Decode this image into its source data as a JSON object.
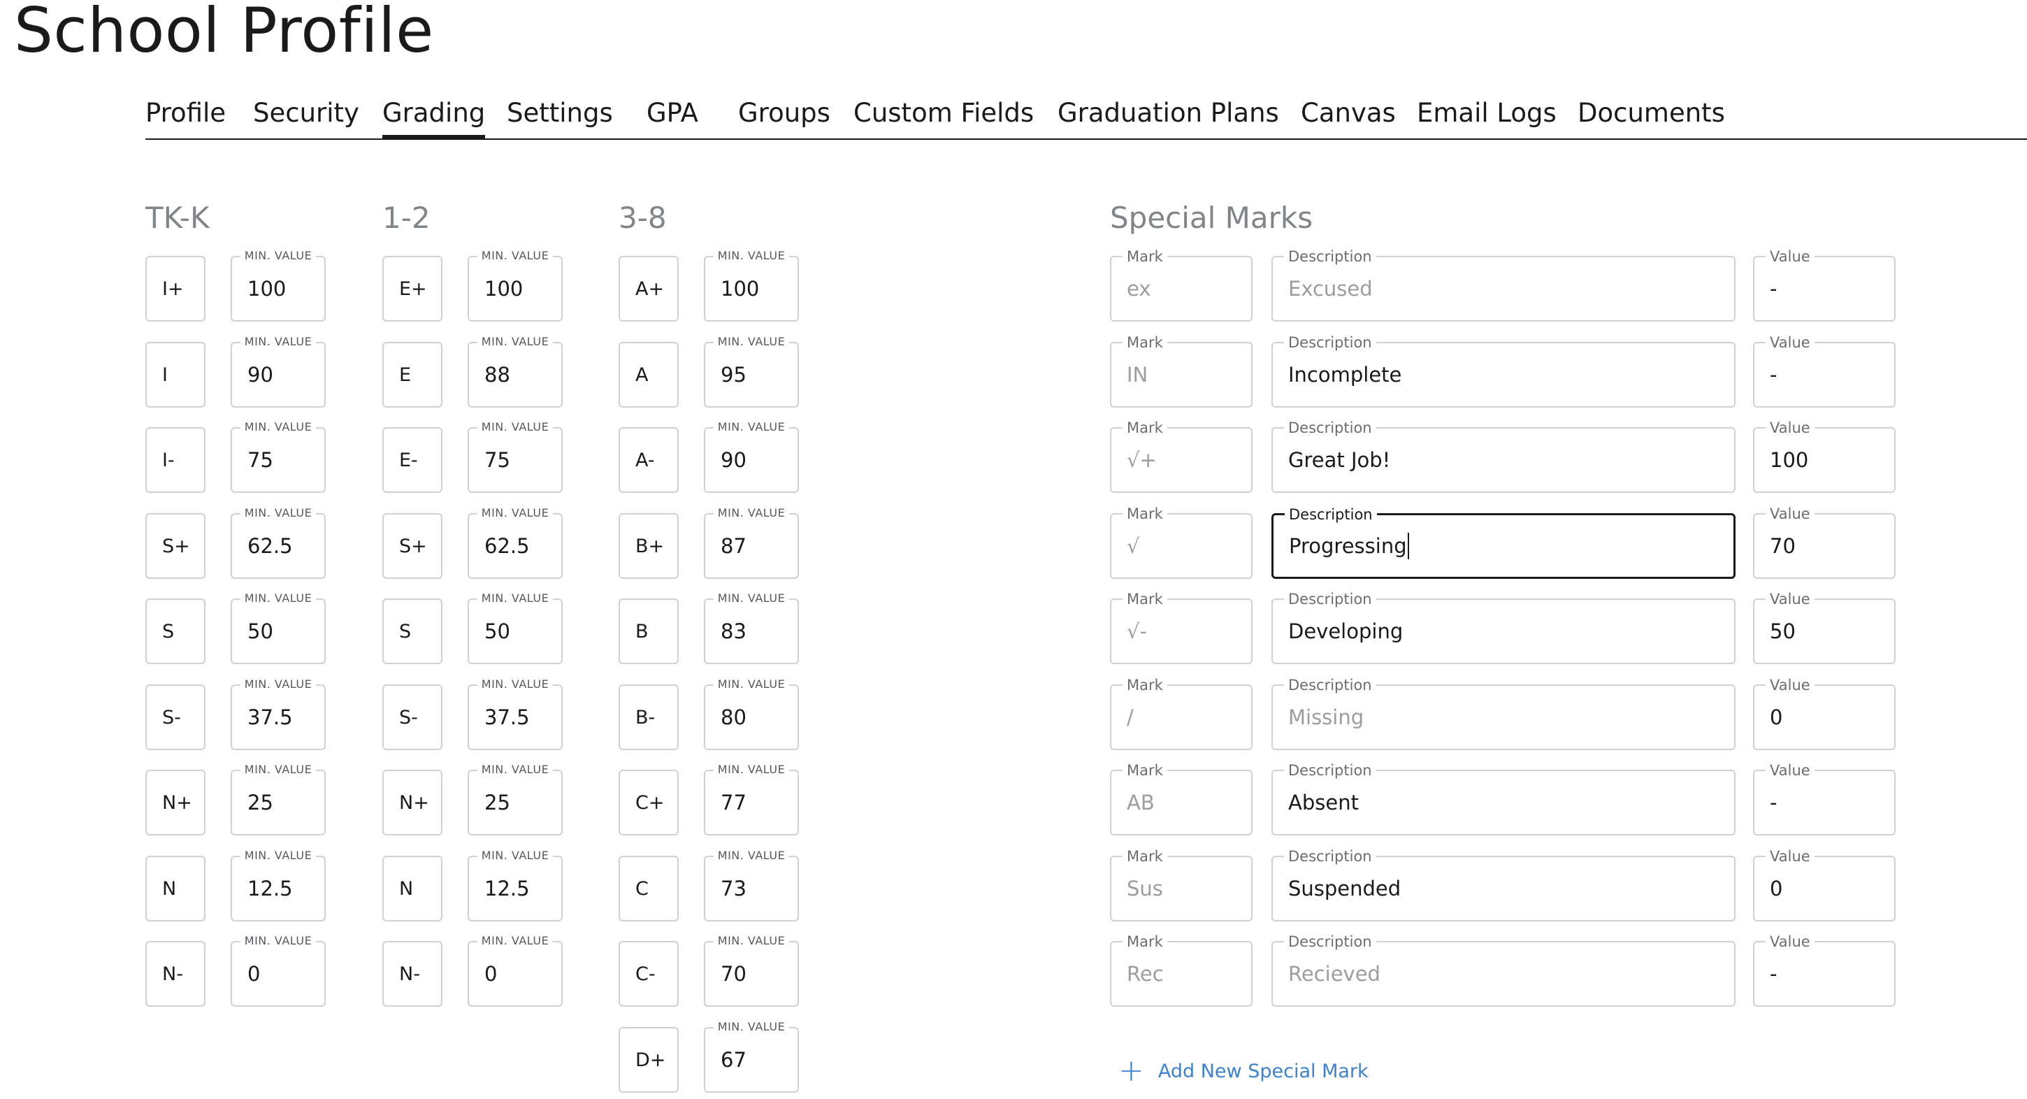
{
  "page_title": "School Profile",
  "tabs": [
    "Profile",
    "Security",
    "Grading",
    "Settings",
    "GPA",
    "Groups",
    "Custom Fields",
    "Graduation Plans",
    "Canvas",
    "Email Logs",
    "Documents"
  ],
  "active_tab": "Grading",
  "min_value_label": "MIN. VALUE",
  "grade_scales": [
    {
      "heading": "TK-K",
      "rows": [
        {
          "mark": "I+",
          "min": "100"
        },
        {
          "mark": "I",
          "min": "90"
        },
        {
          "mark": "I-",
          "min": "75"
        },
        {
          "mark": "S+",
          "min": "62.5"
        },
        {
          "mark": "S",
          "min": "50"
        },
        {
          "mark": "S-",
          "min": "37.5"
        },
        {
          "mark": "N+",
          "min": "25"
        },
        {
          "mark": "N",
          "min": "12.5"
        },
        {
          "mark": "N-",
          "min": "0"
        }
      ]
    },
    {
      "heading": "1-2",
      "rows": [
        {
          "mark": "E+",
          "min": "100"
        },
        {
          "mark": "E",
          "min": "88"
        },
        {
          "mark": "E-",
          "min": "75"
        },
        {
          "mark": "S+",
          "min": "62.5"
        },
        {
          "mark": "S",
          "min": "50"
        },
        {
          "mark": "S-",
          "min": "37.5"
        },
        {
          "mark": "N+",
          "min": "25"
        },
        {
          "mark": "N",
          "min": "12.5"
        },
        {
          "mark": "N-",
          "min": "0"
        }
      ]
    },
    {
      "heading": "3-8",
      "rows": [
        {
          "mark": "A+",
          "min": "100"
        },
        {
          "mark": "A",
          "min": "95"
        },
        {
          "mark": "A-",
          "min": "90"
        },
        {
          "mark": "B+",
          "min": "87"
        },
        {
          "mark": "B",
          "min": "83"
        },
        {
          "mark": "B-",
          "min": "80"
        },
        {
          "mark": "C+",
          "min": "77"
        },
        {
          "mark": "C",
          "min": "73"
        },
        {
          "mark": "C-",
          "min": "70"
        },
        {
          "mark": "D+",
          "min": "67"
        }
      ]
    }
  ],
  "special_marks": {
    "heading": "Special Marks",
    "labels": {
      "mark": "Mark",
      "description": "Description",
      "value": "Value"
    },
    "rows": [
      {
        "mark": "ex",
        "description": "Excused",
        "description_placeholder": true,
        "value": "-"
      },
      {
        "mark": "IN",
        "description": "Incomplete",
        "description_placeholder": false,
        "value": "-"
      },
      {
        "mark": "√+",
        "description": "Great Job!",
        "description_placeholder": false,
        "value": "100"
      },
      {
        "mark": "√",
        "description": "Progressing",
        "description_placeholder": false,
        "value": "70",
        "focused": true
      },
      {
        "mark": "√-",
        "description": "Developing",
        "description_placeholder": false,
        "value": "50"
      },
      {
        "mark": "/",
        "description": "Missing",
        "description_placeholder": true,
        "value": "0"
      },
      {
        "mark": "AB",
        "description": "Absent",
        "description_placeholder": false,
        "value": "-"
      },
      {
        "mark": "Sus",
        "description": "Suspended",
        "description_placeholder": false,
        "value": "0"
      },
      {
        "mark": "Rec",
        "description": "Recieved",
        "description_placeholder": true,
        "value": "-"
      }
    ],
    "add_label": "Add New Special Mark"
  },
  "colors": {
    "accent": "#3b82d0",
    "heading_gray": "#80858c",
    "border": "#cfd1d4",
    "text": "#1a1a1a"
  },
  "icons": {
    "add": "plus-icon"
  }
}
